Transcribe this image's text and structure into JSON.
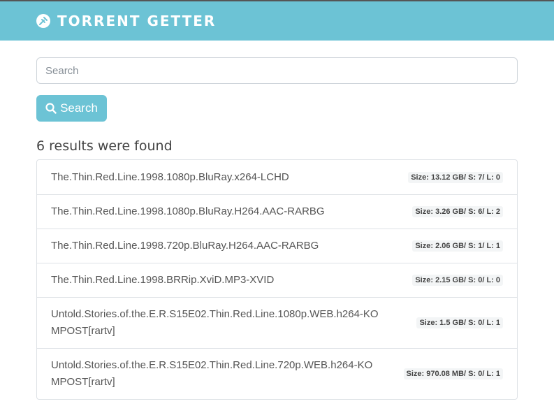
{
  "header": {
    "brand": "TORRENT GETTER",
    "brand_color": "#6cc3d5"
  },
  "search": {
    "placeholder": "Search",
    "value": "",
    "button_label": "Search"
  },
  "results": {
    "heading": "6 results were found",
    "items": [
      {
        "title": "The.Thin.Red.Line.1998.1080p.BluRay.x264-LCHD",
        "meta": "Size: 13.12 GB/ S: 7/ L: 0"
      },
      {
        "title": "The.Thin.Red.Line.1998.1080p.BluRay.H264.AAC-RARBG",
        "meta": "Size: 3.26 GB/ S: 6/ L: 2"
      },
      {
        "title": "The.Thin.Red.Line.1998.720p.BluRay.H264.AAC-RARBG",
        "meta": "Size: 2.06 GB/ S: 1/ L: 1"
      },
      {
        "title": "The.Thin.Red.Line.1998.BRRip.XviD.MP3-XVID",
        "meta": "Size: 2.15 GB/ S: 0/ L: 0"
      },
      {
        "title": "Untold.Stories.of.the.E.R.S15E02.Thin.Red.Line.1080p.WEB.h264-KOMPOST[rartv]",
        "meta": "Size: 1.5 GB/ S: 0/ L: 1"
      },
      {
        "title": "Untold.Stories.of.the.E.R.S15E02.Thin.Red.Line.720p.WEB.h264-KOMPOST[rartv]",
        "meta": "Size: 970.08 MB/ S: 0/ L: 1"
      }
    ]
  }
}
